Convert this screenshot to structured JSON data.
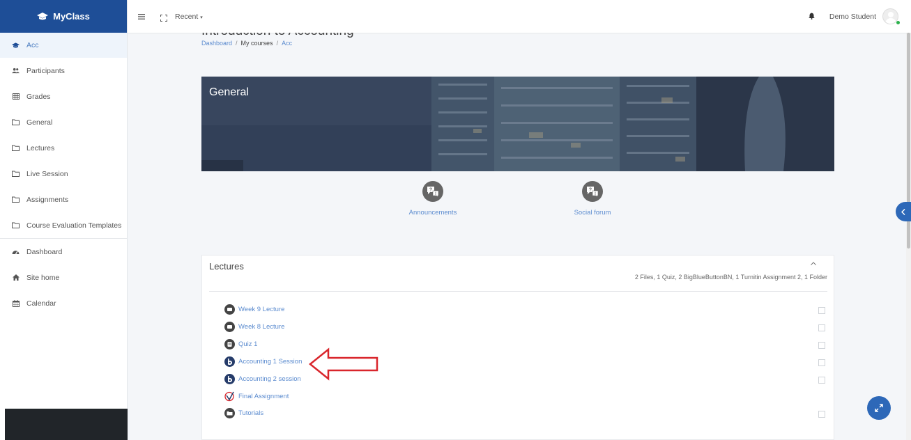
{
  "brand": {
    "name": "MyClass"
  },
  "sidebar": {
    "items": [
      {
        "label": "Acc",
        "icon": "graduation-cap-icon",
        "active": true
      },
      {
        "label": "Participants",
        "icon": "users-icon"
      },
      {
        "label": "Grades",
        "icon": "table-icon"
      },
      {
        "label": "General",
        "icon": "folder-icon"
      },
      {
        "label": "Lectures",
        "icon": "folder-icon"
      },
      {
        "label": "Live Session",
        "icon": "folder-icon"
      },
      {
        "label": "Assignments",
        "icon": "folder-icon"
      },
      {
        "label": "Course Evaluation Templates",
        "icon": "folder-icon"
      },
      {
        "label": "Dashboard",
        "icon": "dashboard-icon"
      },
      {
        "label": "Site home",
        "icon": "home-icon"
      },
      {
        "label": "Calendar",
        "icon": "calendar-icon"
      }
    ]
  },
  "topbar": {
    "recent_label": "Recent",
    "user_name": "Demo Student"
  },
  "course": {
    "title": "Introduction to Accounting",
    "breadcrumb": [
      "Dashboard",
      "My courses",
      "Acc"
    ]
  },
  "banner": {
    "title": "General"
  },
  "activities": [
    {
      "label": "Announcements",
      "icon": "forum-icon"
    },
    {
      "label": "Social forum",
      "icon": "forum-icon"
    }
  ],
  "section": {
    "title": "Lectures",
    "summary": "2 Files, 1 Quiz, 2 BigBlueButtonBN, 1 Turnitin Assignment 2, 1 Folder",
    "items": [
      {
        "label": "Week 9 Lecture",
        "icon": "file-icon",
        "has_checkbox": true
      },
      {
        "label": "Week 8 Lecture",
        "icon": "file-icon",
        "has_checkbox": true
      },
      {
        "label": "Quiz 1",
        "icon": "quiz-icon",
        "has_checkbox": true
      },
      {
        "label": "Accounting 1 Session",
        "icon": "bigbluebutton-icon",
        "has_checkbox": true
      },
      {
        "label": "Accounting 2 session",
        "icon": "bigbluebutton-icon",
        "has_checkbox": true
      },
      {
        "label": "Final Assignment",
        "icon": "turnitin-icon",
        "has_checkbox": false
      },
      {
        "label": "Tutorials",
        "icon": "folder-icon",
        "has_checkbox": true
      }
    ]
  },
  "colors": {
    "brand": "#1e4e97",
    "link": "#5b8bcf",
    "accent_button": "#2d68b8",
    "annotation_arrow": "#d9262c"
  }
}
